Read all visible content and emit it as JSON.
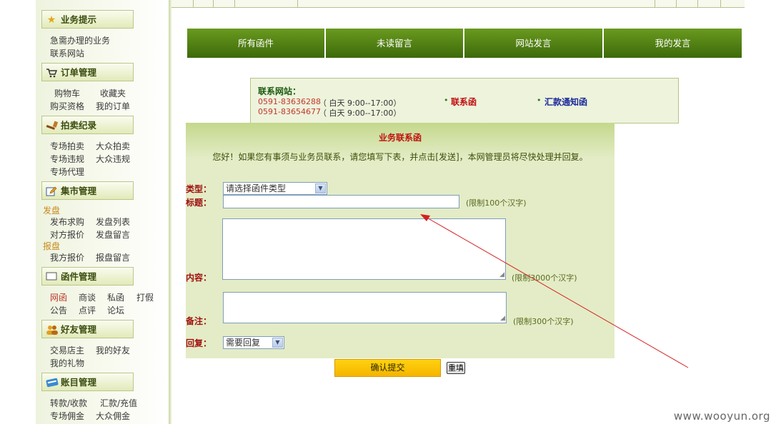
{
  "sidebar": {
    "sections": [
      {
        "title": "业务提示",
        "icon": "star-icon",
        "links": [
          "急需办理的业务",
          "联系网站"
        ]
      },
      {
        "title": "订单管理",
        "icon": "cart-icon",
        "links": [
          "购物车",
          "收藏夹",
          "购买资格",
          "我的订单"
        ]
      },
      {
        "title": "拍卖纪录",
        "icon": "gavel-icon",
        "links": [
          "专场拍卖",
          "大众拍卖",
          "专场违规",
          "大众违规",
          "专场代理"
        ]
      },
      {
        "title": "集市管理",
        "icon": "edit-icon",
        "groups": [
          "发盘",
          "报盘"
        ],
        "links": [
          "发布求购",
          "发盘列表",
          "对方报价",
          "发盘留言",
          "我方报价",
          "报盘留言"
        ]
      },
      {
        "title": "函件管理",
        "icon": "envelope-icon",
        "links": [
          "网函",
          "商谈",
          "私函",
          "打假",
          "公告",
          "点评",
          "论坛"
        ]
      },
      {
        "title": "好友管理",
        "icon": "friends-icon",
        "links": [
          "交易店主",
          "我的好友",
          "我的礼物"
        ]
      },
      {
        "title": "账目管理",
        "icon": "card-icon",
        "links": [
          "转款/收款",
          "汇款/充值",
          "专场佣金",
          "大众佣金"
        ]
      }
    ]
  },
  "nav": {
    "tabs": [
      "所有函件",
      "未读留言",
      "网站发言",
      "我的发言"
    ]
  },
  "contact": {
    "title": "联系网站：",
    "phones": [
      {
        "number": "0591-83636288",
        "hours": "（ 白天 9:00--17:00）"
      },
      {
        "number": "0591-83654677",
        "hours": "（ 白天 9:00--17:00）"
      }
    ],
    "link1": "联系函",
    "link2": "汇款通知函"
  },
  "form": {
    "title": "业务联系函",
    "intro": "您好！如果您有事须与业务员联系，请您填写下表，并点击[发送]，本网管理员将尽快处理并回复。",
    "type_label": "类型：",
    "type_value": "请选择函件类型",
    "subject_label": "标题：",
    "subject_hint": "(限制100个汉字)",
    "content_label": "内容：",
    "content_hint": "(限制3000个汉字)",
    "note_label": "备注：",
    "note_hint": "(限制300个汉字)",
    "reply_label": "回复：",
    "reply_value": "需要回复",
    "submit": "确认提交",
    "reset": "重填"
  },
  "watermark": "www.wooyun.org",
  "colors": {
    "nav_green": "#4f7d14",
    "label_red": "#a01010",
    "submit_yellow": "#ffcc00",
    "annotation_arrow": "#d42020"
  }
}
